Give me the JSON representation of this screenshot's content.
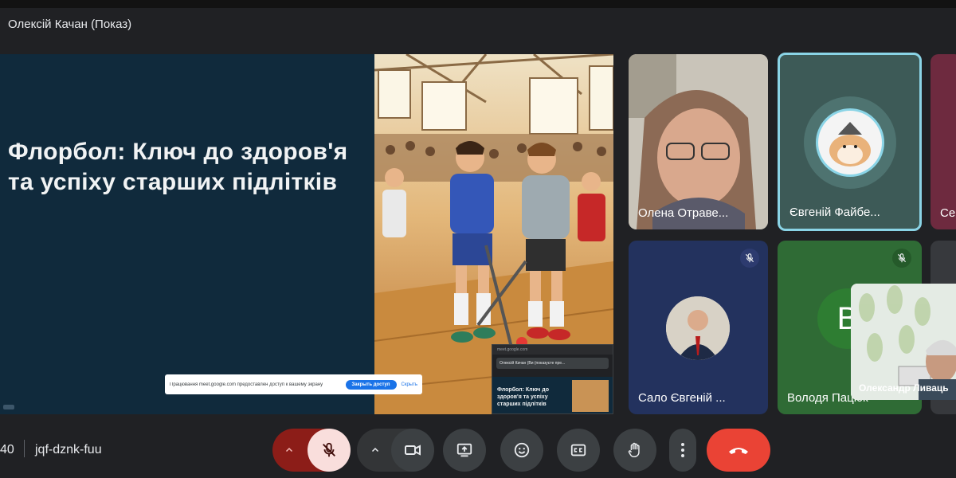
{
  "header": {
    "presenter": "Олексій Качан (Показ)"
  },
  "slide": {
    "title": "Флорбол: Ключ до здоров'я та успіху старших підлітків"
  },
  "share_banner": {
    "message": "Працювання meet.google.com предоставлен доступ к вашему экрану",
    "stop_label": "Закрыть доступ",
    "hide_label": "Скрыть"
  },
  "mini_window": {
    "url": "meet.google.com",
    "tab_label": "Олексій Качан (Ви (показуєте пре...",
    "slide_title": "Флорбол: Ключ до здоров'я та успіху старших підлітків"
  },
  "participants": [
    {
      "name": "Олена Отраве...",
      "muted": false
    },
    {
      "name": "Євгеній Файбе...",
      "muted": false,
      "active_speaker": true
    },
    {
      "name": "Се",
      "muted": false
    },
    {
      "name": "Сало Євгеній ...",
      "muted": true
    },
    {
      "name": "Володя Пацюк",
      "muted": true,
      "initial": "В"
    }
  ],
  "self_view": {
    "name": "Олександр Ливаць"
  },
  "meeting": {
    "time": "40",
    "code": "jqf-dznk-fuu"
  },
  "controls": {
    "mic": "mic-off",
    "camera": "camera",
    "present": "present",
    "reactions": "emoji",
    "captions": "captions",
    "raise_hand": "hand",
    "more": "more",
    "leave": "leave-call"
  },
  "colors": {
    "accent": "#1a73e8",
    "leave": "#ea4335",
    "mic_off_bg": "#f9dedc",
    "mic_group_bg": "#8c1d18",
    "active_border": "#8ad4e6"
  }
}
